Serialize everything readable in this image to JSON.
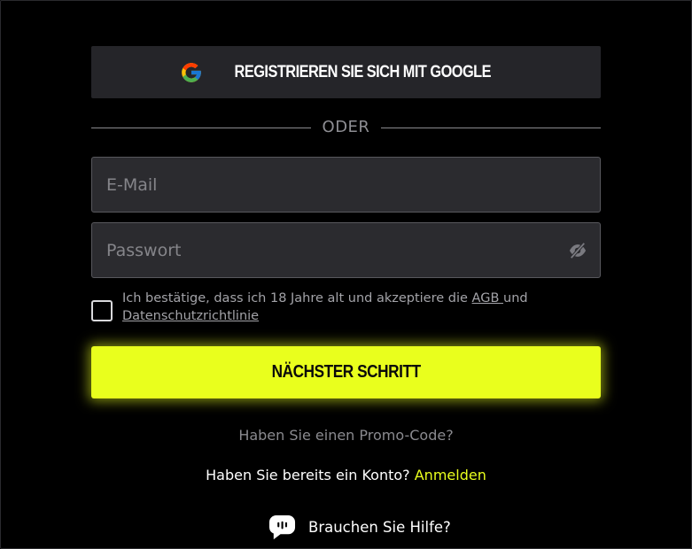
{
  "google_button": {
    "label": "REGISTRIEREN SIE SICH MIT GOOGLE",
    "icon": "google-icon"
  },
  "divider": {
    "text": "ODER"
  },
  "email": {
    "placeholder": "E-Mail",
    "value": ""
  },
  "password": {
    "placeholder": "Passwort",
    "value": "",
    "toggle_icon": "eye-slash-icon"
  },
  "consent": {
    "checked": false,
    "text_before": "Ich bestätige, dass ich 18 Jahre alt und akzeptiere die ",
    "agb_link": "AGB ",
    "text_middle": "und ",
    "privacy_link": "Datenschutzrichtlinie"
  },
  "next_button": {
    "label": "NÄCHSTER SCHRITT"
  },
  "promo": {
    "text": "Haben Sie einen Promo-Code?"
  },
  "account": {
    "text": "Haben Sie bereits ein Konto? ",
    "login_link": "Anmelden"
  },
  "help": {
    "label": "Brauchen Sie Hilfe?",
    "icon": "chat-bubble-icon"
  },
  "colors": {
    "background": "#000000",
    "accent": "#e9ff1d",
    "button_dark": "#252529",
    "input_bg": "#2b2b2f",
    "muted_text": "#8a8a8f"
  }
}
